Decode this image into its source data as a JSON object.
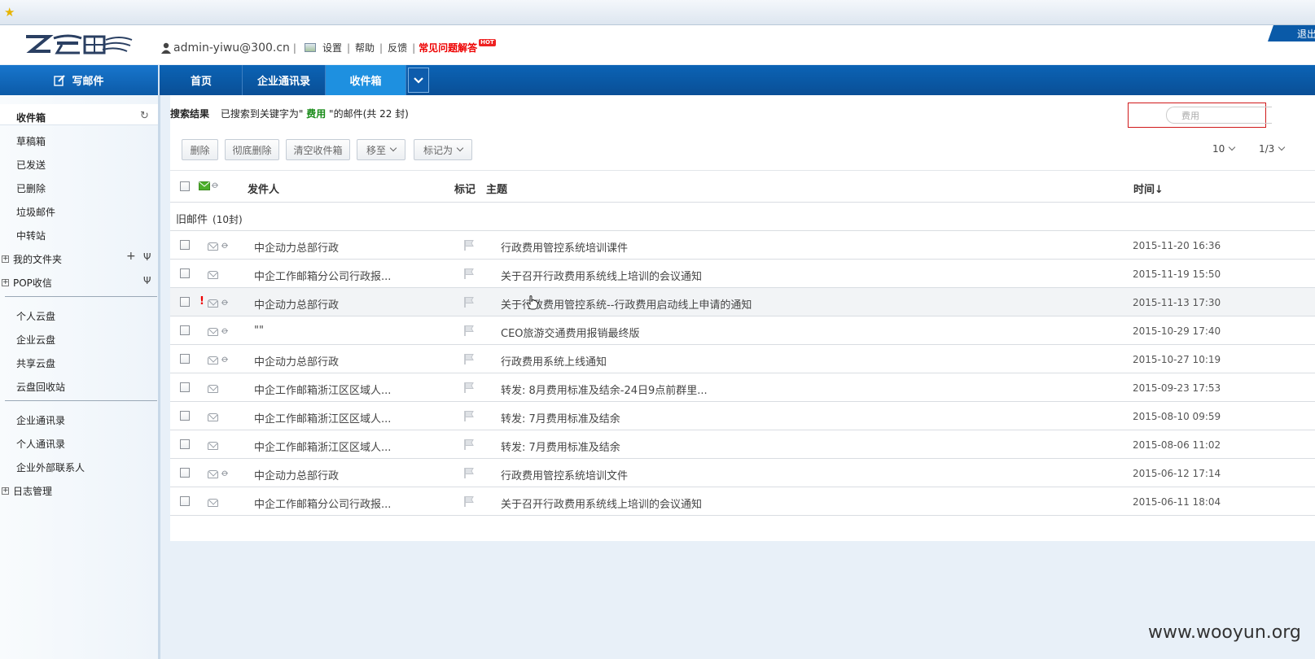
{
  "header": {
    "user": "admin-yiwu@300.cn",
    "links": [
      "设置",
      "帮助",
      "反馈"
    ],
    "faq": "常见问题解答",
    "hot_badge": "HOT",
    "logout": "退出"
  },
  "nav": {
    "compose": "写邮件",
    "tabs": [
      "首页",
      "企业通讯录",
      "收件箱"
    ],
    "active_tab": "收件箱"
  },
  "sidebar": {
    "mail_items": [
      "收件箱",
      "草稿箱",
      "已发送",
      "已删除",
      "垃圾邮件",
      "中转站"
    ],
    "my_folders": "我的文件夹",
    "pop": "POP收信",
    "cloud_items": [
      "个人云盘",
      "企业云盘",
      "共享云盘",
      "云盘回收站"
    ],
    "contact_items": [
      "企业通讯录",
      "个人通讯录",
      "企业外部联系人"
    ],
    "log": "日志管理"
  },
  "search": {
    "label": "搜索结果",
    "prefix": "已搜索到关键字为\"",
    "keyword": "费用",
    "suffix": "\"的邮件(共 22 封)",
    "placeholder": "费用"
  },
  "toolbar": {
    "delete": "删除",
    "delete_forever": "彻底删除",
    "empty": "清空收件箱",
    "move": "移至",
    "mark": "标记为",
    "page_size": "10",
    "page": "1/3"
  },
  "columns": {
    "sender": "发件人",
    "flag": "标记",
    "subject": "主题",
    "time": "时间↓"
  },
  "group": {
    "title": "旧邮件",
    "count": "(10封)"
  },
  "emails": [
    {
      "sender": "中企动力总部行政",
      "subject": "行政费用管控系统培训课件",
      "time": "2015-11-20 16:36",
      "attach": true,
      "important": false
    },
    {
      "sender": "中企工作邮箱分公司行政报...",
      "subject": "关于召开行政费用系统线上培训的会议通知",
      "time": "2015-11-19 15:50",
      "attach": false,
      "important": false
    },
    {
      "sender": "中企动力总部行政",
      "subject": "关于行政费用管控系统--行政费用启动线上申请的通知",
      "time": "2015-11-13 17:30",
      "attach": true,
      "important": true
    },
    {
      "sender": "\"\"",
      "subject": "CEO旅游交通费用报销最终版",
      "time": "2015-10-29 17:40",
      "attach": true,
      "important": false
    },
    {
      "sender": "中企动力总部行政",
      "subject": "行政费用系统上线通知",
      "time": "2015-10-27 10:19",
      "attach": true,
      "important": false
    },
    {
      "sender": "中企工作邮箱浙江区区域人...",
      "subject": "转发: 8月费用标准及结余-24日9点前群里...",
      "time": "2015-09-23 17:53",
      "attach": false,
      "important": false
    },
    {
      "sender": "中企工作邮箱浙江区区域人...",
      "subject": "转发: 7月费用标准及结余",
      "time": "2015-08-10 09:59",
      "attach": false,
      "important": false
    },
    {
      "sender": "中企工作邮箱浙江区区域人...",
      "subject": "转发: 7月费用标准及结余",
      "time": "2015-08-06 11:02",
      "attach": false,
      "important": false
    },
    {
      "sender": "中企动力总部行政",
      "subject": "行政费用管控系统培训文件",
      "time": "2015-06-12 17:14",
      "attach": true,
      "important": false
    },
    {
      "sender": "中企工作邮箱分公司行政报...",
      "subject": "关于召开行政费用系统线上培训的会议通知",
      "time": "2015-06-11 18:04",
      "attach": false,
      "important": false
    }
  ],
  "watermark": "www.wooyun.org",
  "colors": {
    "nav": "#0b5aa8",
    "active_tab": "#1e90e0",
    "keyword": "#1a8c1a",
    "faq": "#e00000"
  }
}
